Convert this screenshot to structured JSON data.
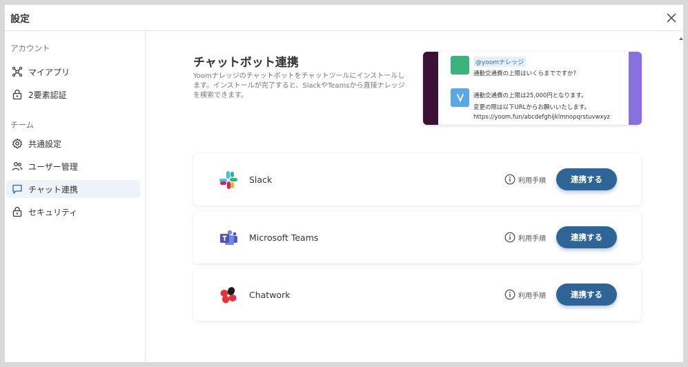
{
  "window": {
    "title": "設定"
  },
  "sidebar": {
    "account_label": "アカウント",
    "account_items": [
      {
        "label": "マイアプリ",
        "icon": "app-network-icon"
      },
      {
        "label": "2要素認証",
        "icon": "lock-icon"
      }
    ],
    "team_label": "チーム",
    "team_items": [
      {
        "label": "共通設定",
        "icon": "gear-icon"
      },
      {
        "label": "ユーザー管理",
        "icon": "users-icon"
      },
      {
        "label": "チャット連携",
        "icon": "chat-bubble-icon",
        "active": true
      },
      {
        "label": "セキュリティ",
        "icon": "lock-icon"
      }
    ]
  },
  "main": {
    "title": "チャットボット連携",
    "description": "Yoomナレッジのチャットボットをチャットツールにインストールします。インストールが完了すると、SlackやTeamsから直接ナレッジを検索できます。",
    "preview": {
      "mention": "@yoomナレッジ",
      "question": "通勤交通費の上限はいくらまでですか？",
      "answer_line1": "通勤交通費の上限は25,000円となります。",
      "answer_line2": "変更の際は以下URLからお願いいたします。",
      "answer_url": "https://yoom.fun/abcdefghijklmnopqrstuvwxyz"
    },
    "integrations": [
      {
        "name": "Slack",
        "help": "利用手順",
        "button": "連携する"
      },
      {
        "name": "Microsoft Teams",
        "help": "利用手順",
        "button": "連携する"
      },
      {
        "name": "Chatwork",
        "help": "利用手順",
        "button": "連携する"
      }
    ]
  },
  "colors": {
    "accent": "#2f6497",
    "active_nav_bg": "#eef3f9",
    "slack_sidebar": "#3c1138",
    "teams_purple": "#8a6fe0"
  }
}
